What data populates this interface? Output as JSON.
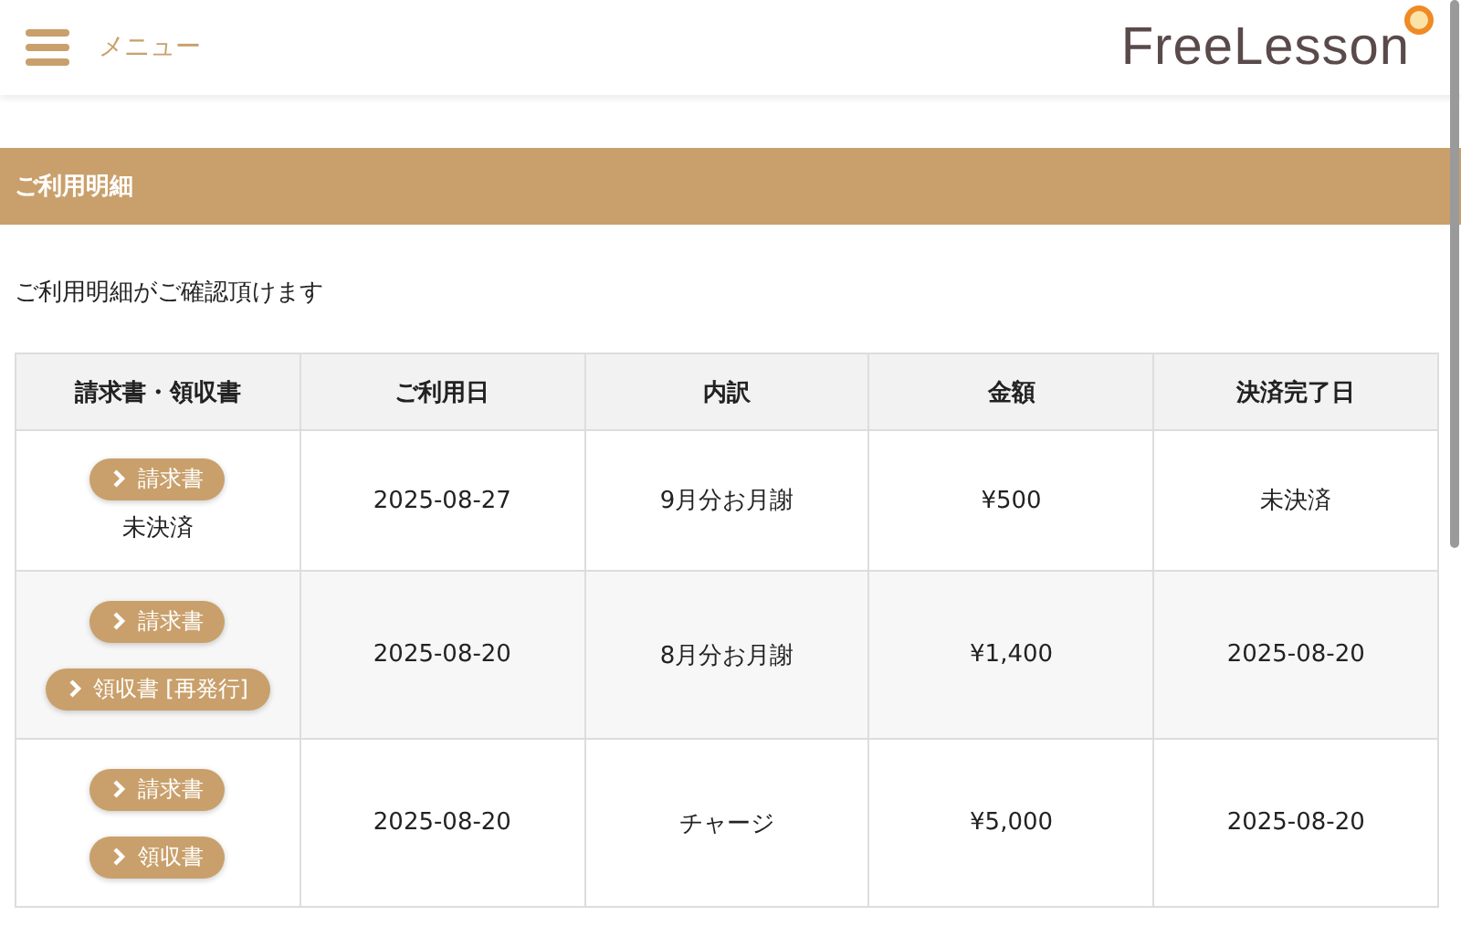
{
  "header": {
    "menu_label": "メニュー",
    "logo": "FreeLesson"
  },
  "section": {
    "title": "ご利用明細",
    "description": "ご利用明細がご確認頂けます"
  },
  "table": {
    "columns": [
      "請求書・領収書",
      "ご利用日",
      "内訳",
      "金額",
      "決済完了日"
    ],
    "rows": [
      {
        "buttons": [
          "請求書"
        ],
        "status": "未決済",
        "date": "2025-08-27",
        "item": "9月分お月謝",
        "amount": "¥500",
        "paid_date": "未決済"
      },
      {
        "buttons": [
          "請求書",
          "領収書 [再発行]"
        ],
        "date": "2025-08-20",
        "item": "8月分お月謝",
        "amount": "¥1,400",
        "paid_date": "2025-08-20"
      },
      {
        "buttons": [
          "請求書",
          "領収書"
        ],
        "date": "2025-08-20",
        "item": "チャージ",
        "amount": "¥5,000",
        "paid_date": "2025-08-20"
      }
    ]
  }
}
